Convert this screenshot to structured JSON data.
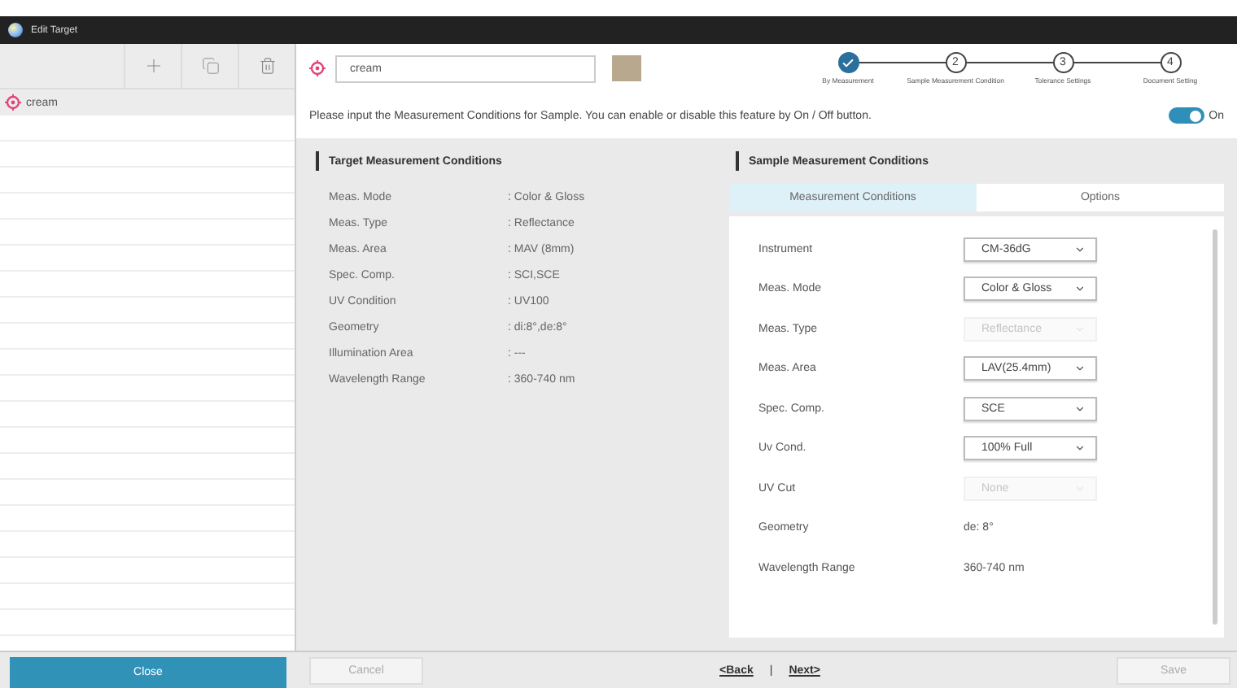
{
  "window": {
    "title": "Edit Target"
  },
  "targets": [
    {
      "name": "cream",
      "selected": true
    }
  ],
  "name_field": {
    "value": "cream"
  },
  "steps": [
    {
      "label": "By Measurement",
      "done": true
    },
    {
      "label": "Sample Measurement Condition",
      "number": "2",
      "done": false
    },
    {
      "label": "Tolerance Settings",
      "number": "3",
      "done": false
    },
    {
      "label": "Document Setting",
      "number": "4",
      "done": false
    }
  ],
  "instruction": "Please input the Measurement Conditions for Sample. You can enable or disable this feature by On / Off button.",
  "toggle": {
    "on": true,
    "label": "On"
  },
  "target_conditions": {
    "title": "Target Measurement Conditions",
    "rows": [
      {
        "label": "Meas. Mode",
        "value": ": Color & Gloss"
      },
      {
        "label": "Meas. Type",
        "value": ": Reflectance"
      },
      {
        "label": "Meas. Area",
        "value": ": MAV (8mm)"
      },
      {
        "label": "Spec. Comp.",
        "value": ": SCI,SCE"
      },
      {
        "label": "UV Condition",
        "value": ": UV100"
      },
      {
        "label": "Geometry",
        "value": ": di:8°,de:8°"
      },
      {
        "label": "Illumination Area",
        "value": ": ---"
      },
      {
        "label": "Wavelength Range",
        "value": ": 360-740 nm"
      }
    ]
  },
  "sample_conditions": {
    "title": "Sample Measurement Conditions",
    "tabs": [
      {
        "label": "Measurement Conditions",
        "selected": true
      },
      {
        "label": "Options",
        "selected": false
      }
    ],
    "rows": [
      {
        "label": "Instrument",
        "value": "CM-36dG",
        "kind": "select",
        "disabled": false
      },
      {
        "label": "Meas. Mode",
        "value": "Color & Gloss",
        "kind": "select",
        "disabled": false
      },
      {
        "label": "Meas. Type",
        "value": "Reflectance",
        "kind": "select",
        "disabled": true
      },
      {
        "label": "Meas. Area",
        "value": "LAV(25.4mm)",
        "kind": "select",
        "disabled": false
      },
      {
        "label": "Spec. Comp.",
        "value": "SCE",
        "kind": "select",
        "disabled": false
      },
      {
        "label": "Uv Cond.",
        "value": "100% Full",
        "kind": "select",
        "disabled": false
      },
      {
        "label": "UV Cut",
        "value": "None",
        "kind": "select",
        "disabled": true
      },
      {
        "label": "Geometry",
        "value": "de: 8°",
        "kind": "text"
      },
      {
        "label": "Wavelength Range",
        "value": "360-740 nm",
        "kind": "text"
      }
    ]
  },
  "footer": {
    "close": "Close",
    "cancel": {
      "label": "Cancel",
      "disabled": true
    },
    "back": "<Back",
    "separator": "|",
    "next": "Next>",
    "save": {
      "label": "Save",
      "disabled": true
    }
  }
}
